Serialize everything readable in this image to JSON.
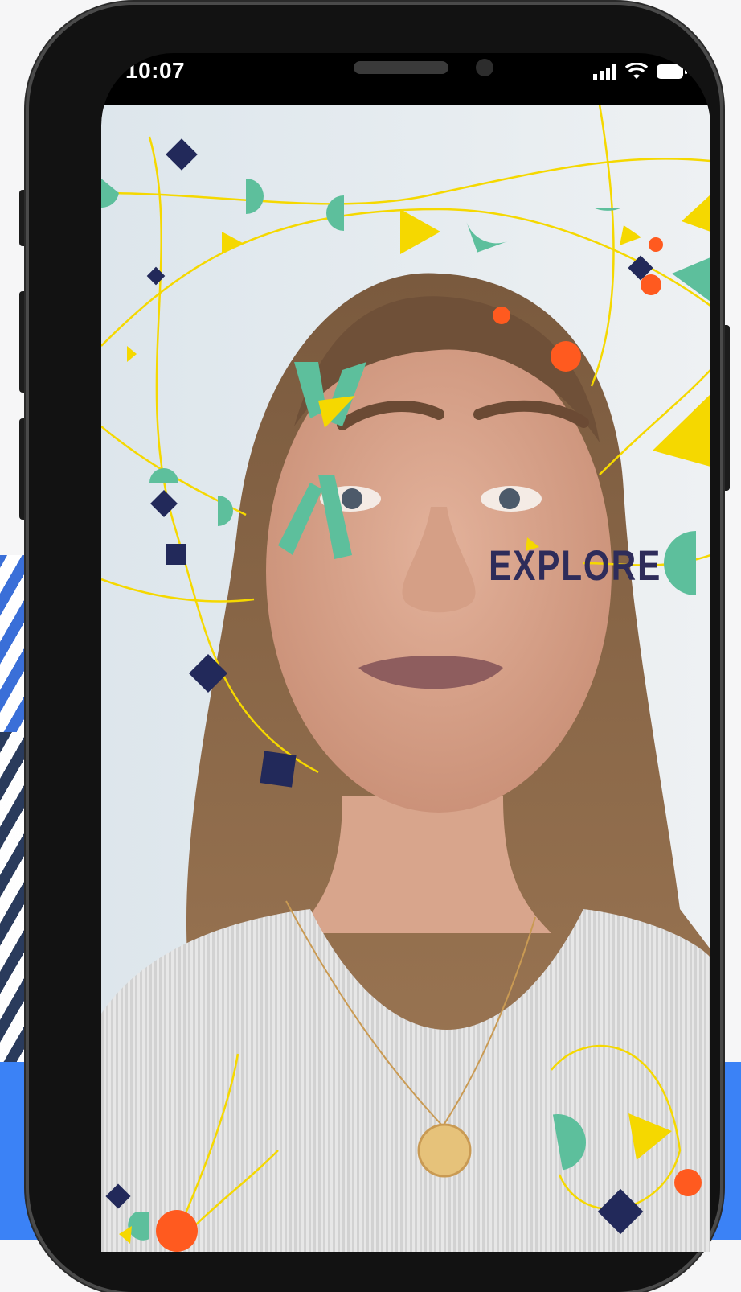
{
  "status_bar": {
    "time": "10:07",
    "icons": [
      "cellular-signal-icon",
      "wifi-icon",
      "battery-icon"
    ]
  },
  "camera_filter": {
    "face_sticker_text": "EXPLORE",
    "colors": {
      "yellow": "#f5d800",
      "teal": "#5dbf9c",
      "navy": "#22295a",
      "orange": "#ff5a1f"
    }
  },
  "background": {
    "stripes_color": "#1f3154",
    "band_color": "#3b82f6"
  }
}
